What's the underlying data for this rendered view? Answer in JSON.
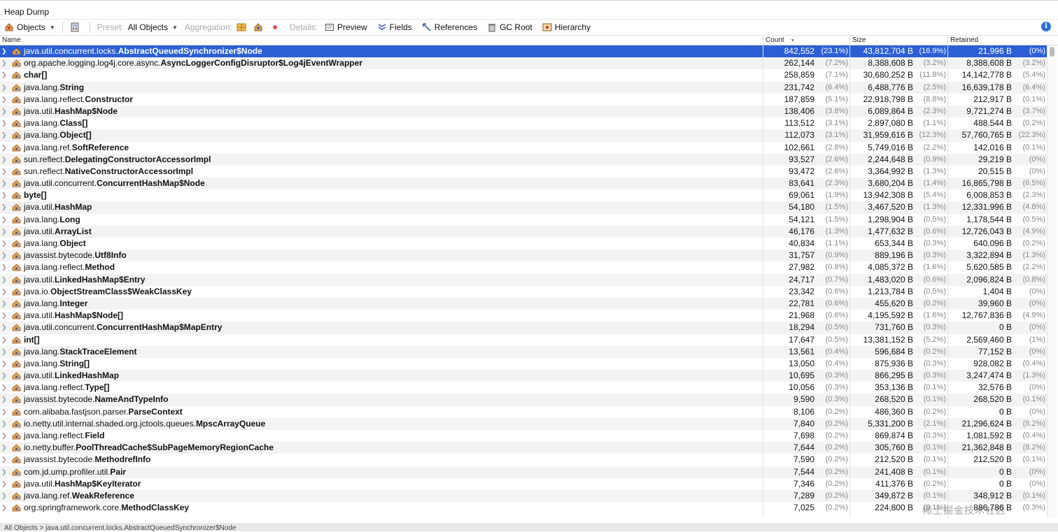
{
  "window": {
    "title": "Heap Dump"
  },
  "toolbar": {
    "view_label": "Objects",
    "preset_label": "Preset:",
    "preset_value": "All Objects",
    "aggregation_label": "Aggregation:",
    "details_label": "Details:",
    "preview": "Preview",
    "fields": "Fields",
    "references": "References",
    "gc_root": "GC Root",
    "hierarchy": "Hierarchy"
  },
  "columns": {
    "name": "Name",
    "count": "Count",
    "size": "Size",
    "retained": "Retained"
  },
  "rows": [
    {
      "pre": "java.util.concurrent.locks.",
      "name": "AbstractQueuedSynchronizer$Node",
      "count": "842,552",
      "count_pct": "(23.1%)",
      "size": "43,812,704 B",
      "size_pct": "(16.9%)",
      "retained": "21,996 B",
      "retained_pct": "(0%)"
    },
    {
      "pre": "org.apache.logging.log4j.core.async.",
      "name": "AsyncLoggerConfigDisruptor$Log4jEventWrapper",
      "count": "262,144",
      "count_pct": "(7.2%)",
      "size": "8,388,608 B",
      "size_pct": "(3.2%)",
      "retained": "8,388,608 B",
      "retained_pct": "(3.2%)"
    },
    {
      "pre": "",
      "name": "char[]",
      "count": "258,859",
      "count_pct": "(7.1%)",
      "size": "30,680,252 B",
      "size_pct": "(11.8%)",
      "retained": "14,142,778 B",
      "retained_pct": "(5.4%)"
    },
    {
      "pre": "java.lang.",
      "name": "String",
      "count": "231,742",
      "count_pct": "(6.4%)",
      "size": "6,488,776 B",
      "size_pct": "(2.5%)",
      "retained": "16,639,178 B",
      "retained_pct": "(6.4%)"
    },
    {
      "pre": "java.lang.reflect.",
      "name": "Constructor",
      "count": "187,859",
      "count_pct": "(5.1%)",
      "size": "22,918,798 B",
      "size_pct": "(8.8%)",
      "retained": "212,917 B",
      "retained_pct": "(0.1%)"
    },
    {
      "pre": "java.util.",
      "name": "HashMap$Node",
      "count": "138,406",
      "count_pct": "(3.8%)",
      "size": "6,089,864 B",
      "size_pct": "(2.3%)",
      "retained": "9,721,274 B",
      "retained_pct": "(3.7%)"
    },
    {
      "pre": "java.lang.",
      "name": "Class[]",
      "count": "113,512",
      "count_pct": "(3.1%)",
      "size": "2,897,080 B",
      "size_pct": "(1.1%)",
      "retained": "488,544 B",
      "retained_pct": "(0.2%)"
    },
    {
      "pre": "java.lang.",
      "name": "Object[]",
      "count": "112,073",
      "count_pct": "(3.1%)",
      "size": "31,959,616 B",
      "size_pct": "(12.3%)",
      "retained": "57,760,765 B",
      "retained_pct": "(22.3%)"
    },
    {
      "pre": "java.lang.ref.",
      "name": "SoftReference",
      "count": "102,661",
      "count_pct": "(2.8%)",
      "size": "5,749,016 B",
      "size_pct": "(2.2%)",
      "retained": "142,016 B",
      "retained_pct": "(0.1%)"
    },
    {
      "pre": "sun.reflect.",
      "name": "DelegatingConstructorAccessorImpl",
      "count": "93,527",
      "count_pct": "(2.6%)",
      "size": "2,244,648 B",
      "size_pct": "(0.9%)",
      "retained": "29,219 B",
      "retained_pct": "(0%)"
    },
    {
      "pre": "sun.reflect.",
      "name": "NativeConstructorAccessorImpl",
      "count": "93,472",
      "count_pct": "(2.6%)",
      "size": "3,364,992 B",
      "size_pct": "(1.3%)",
      "retained": "20,515 B",
      "retained_pct": "(0%)"
    },
    {
      "pre": "java.util.concurrent.",
      "name": "ConcurrentHashMap$Node",
      "count": "83,641",
      "count_pct": "(2.3%)",
      "size": "3,680,204 B",
      "size_pct": "(1.4%)",
      "retained": "16,865,798 B",
      "retained_pct": "(6.5%)"
    },
    {
      "pre": "",
      "name": "byte[]",
      "count": "69,061",
      "count_pct": "(1.9%)",
      "size": "13,942,308 B",
      "size_pct": "(5.4%)",
      "retained": "6,008,853 B",
      "retained_pct": "(2.3%)"
    },
    {
      "pre": "java.util.",
      "name": "HashMap",
      "count": "54,180",
      "count_pct": "(1.5%)",
      "size": "3,467,520 B",
      "size_pct": "(1.3%)",
      "retained": "12,331,996 B",
      "retained_pct": "(4.8%)"
    },
    {
      "pre": "java.lang.",
      "name": "Long",
      "count": "54,121",
      "count_pct": "(1.5%)",
      "size": "1,298,904 B",
      "size_pct": "(0.5%)",
      "retained": "1,178,544 B",
      "retained_pct": "(0.5%)"
    },
    {
      "pre": "java.util.",
      "name": "ArrayList",
      "count": "46,176",
      "count_pct": "(1.3%)",
      "size": "1,477,632 B",
      "size_pct": "(0.6%)",
      "retained": "12,726,043 B",
      "retained_pct": "(4.9%)"
    },
    {
      "pre": "java.lang.",
      "name": "Object",
      "count": "40,834",
      "count_pct": "(1.1%)",
      "size": "653,344 B",
      "size_pct": "(0.3%)",
      "retained": "640,096 B",
      "retained_pct": "(0.2%)"
    },
    {
      "pre": "javassist.bytecode.",
      "name": "Utf8Info",
      "count": "31,757",
      "count_pct": "(0.9%)",
      "size": "889,196 B",
      "size_pct": "(0.3%)",
      "retained": "3,322,894 B",
      "retained_pct": "(1.3%)"
    },
    {
      "pre": "java.lang.reflect.",
      "name": "Method",
      "count": "27,982",
      "count_pct": "(0.8%)",
      "size": "4,085,372 B",
      "size_pct": "(1.6%)",
      "retained": "5,620,585 B",
      "retained_pct": "(2.2%)"
    },
    {
      "pre": "java.util.",
      "name": "LinkedHashMap$Entry",
      "count": "24,717",
      "count_pct": "(0.7%)",
      "size": "1,483,020 B",
      "size_pct": "(0.6%)",
      "retained": "2,096,824 B",
      "retained_pct": "(0.8%)"
    },
    {
      "pre": "java.io.",
      "name": "ObjectStreamClass$WeakClassKey",
      "count": "23,342",
      "count_pct": "(0.6%)",
      "size": "1,213,784 B",
      "size_pct": "(0.5%)",
      "retained": "1,404 B",
      "retained_pct": "(0%)"
    },
    {
      "pre": "java.lang.",
      "name": "Integer",
      "count": "22,781",
      "count_pct": "(0.6%)",
      "size": "455,620 B",
      "size_pct": "(0.2%)",
      "retained": "39,960 B",
      "retained_pct": "(0%)"
    },
    {
      "pre": "java.util.",
      "name": "HashMap$Node[]",
      "count": "21,968",
      "count_pct": "(0.6%)",
      "size": "4,195,592 B",
      "size_pct": "(1.6%)",
      "retained": "12,767,836 B",
      "retained_pct": "(4.9%)"
    },
    {
      "pre": "java.util.concurrent.",
      "name": "ConcurrentHashMap$MapEntry",
      "count": "18,294",
      "count_pct": "(0.5%)",
      "size": "731,760 B",
      "size_pct": "(0.3%)",
      "retained": "0 B",
      "retained_pct": "(0%)"
    },
    {
      "pre": "",
      "name": "int[]",
      "count": "17,647",
      "count_pct": "(0.5%)",
      "size": "13,381,152 B",
      "size_pct": "(5.2%)",
      "retained": "2,569,460 B",
      "retained_pct": "(1%)"
    },
    {
      "pre": "java.lang.",
      "name": "StackTraceElement",
      "count": "13,561",
      "count_pct": "(0.4%)",
      "size": "596,684 B",
      "size_pct": "(0.2%)",
      "retained": "77,152 B",
      "retained_pct": "(0%)"
    },
    {
      "pre": "java.lang.",
      "name": "String[]",
      "count": "13,050",
      "count_pct": "(0.4%)",
      "size": "875,936 B",
      "size_pct": "(0.3%)",
      "retained": "928,082 B",
      "retained_pct": "(0.4%)"
    },
    {
      "pre": "java.util.",
      "name": "LinkedHashMap",
      "count": "10,695",
      "count_pct": "(0.3%)",
      "size": "866,295 B",
      "size_pct": "(0.3%)",
      "retained": "3,247,474 B",
      "retained_pct": "(1.3%)"
    },
    {
      "pre": "java.lang.reflect.",
      "name": "Type[]",
      "count": "10,056",
      "count_pct": "(0.3%)",
      "size": "353,136 B",
      "size_pct": "(0.1%)",
      "retained": "32,576 B",
      "retained_pct": "(0%)"
    },
    {
      "pre": "javassist.bytecode.",
      "name": "NameAndTypeInfo",
      "count": "9,590",
      "count_pct": "(0.3%)",
      "size": "268,520 B",
      "size_pct": "(0.1%)",
      "retained": "268,520 B",
      "retained_pct": "(0.1%)"
    },
    {
      "pre": "com.alibaba.fastjson.parser.",
      "name": "ParseContext",
      "count": "8,106",
      "count_pct": "(0.2%)",
      "size": "486,360 B",
      "size_pct": "(0.2%)",
      "retained": "0 B",
      "retained_pct": "(0%)"
    },
    {
      "pre": "io.netty.util.internal.shaded.org.jctools.queues.",
      "name": "MpscArrayQueue",
      "count": "7,840",
      "count_pct": "(0.2%)",
      "size": "5,331,200 B",
      "size_pct": "(2.1%)",
      "retained": "21,296,624 B",
      "retained_pct": "(8.2%)"
    },
    {
      "pre": "java.lang.reflect.",
      "name": "Field",
      "count": "7,698",
      "count_pct": "(0.2%)",
      "size": "869,874 B",
      "size_pct": "(0.3%)",
      "retained": "1,081,592 B",
      "retained_pct": "(0.4%)"
    },
    {
      "pre": "io.netty.buffer.",
      "name": "PoolThreadCache$SubPageMemoryRegionCache",
      "count": "7,644",
      "count_pct": "(0.2%)",
      "size": "305,760 B",
      "size_pct": "(0.1%)",
      "retained": "21,362,848 B",
      "retained_pct": "(8.2%)"
    },
    {
      "pre": "javassist.bytecode.",
      "name": "MethodrefInfo",
      "count": "7,590",
      "count_pct": "(0.2%)",
      "size": "212,520 B",
      "size_pct": "(0.1%)",
      "retained": "212,520 B",
      "retained_pct": "(0.1%)"
    },
    {
      "pre": "com.jd.ump.profiler.util.",
      "name": "Pair",
      "count": "7,544",
      "count_pct": "(0.2%)",
      "size": "241,408 B",
      "size_pct": "(0.1%)",
      "retained": "0 B",
      "retained_pct": "(0%)"
    },
    {
      "pre": "java.util.",
      "name": "HashMap$KeyIterator",
      "count": "7,346",
      "count_pct": "(0.2%)",
      "size": "411,376 B",
      "size_pct": "(0.2%)",
      "retained": "0 B",
      "retained_pct": "(0%)"
    },
    {
      "pre": "java.lang.ref.",
      "name": "WeakReference",
      "count": "7,289",
      "count_pct": "(0.2%)",
      "size": "349,872 B",
      "size_pct": "(0.1%)",
      "retained": "348,912 B",
      "retained_pct": "(0.1%)"
    },
    {
      "pre": "org.springframework.core.",
      "name": "MethodClassKey",
      "count": "7,025",
      "count_pct": "(0.2%)",
      "size": "224,800 B",
      "size_pct": "(0.1%)",
      "retained": "886,786 B",
      "retained_pct": "(0.3%)"
    }
  ],
  "status": {
    "text": "All Objects  >  java.util.concurrent.locks.AbstractQueuedSynchronizer$Node"
  },
  "watermark": "稀土掘金技术社区",
  "colors": {
    "selection": "#2c5fd4",
    "stripe": "#f3f3f3",
    "info": "#2f73d2"
  }
}
